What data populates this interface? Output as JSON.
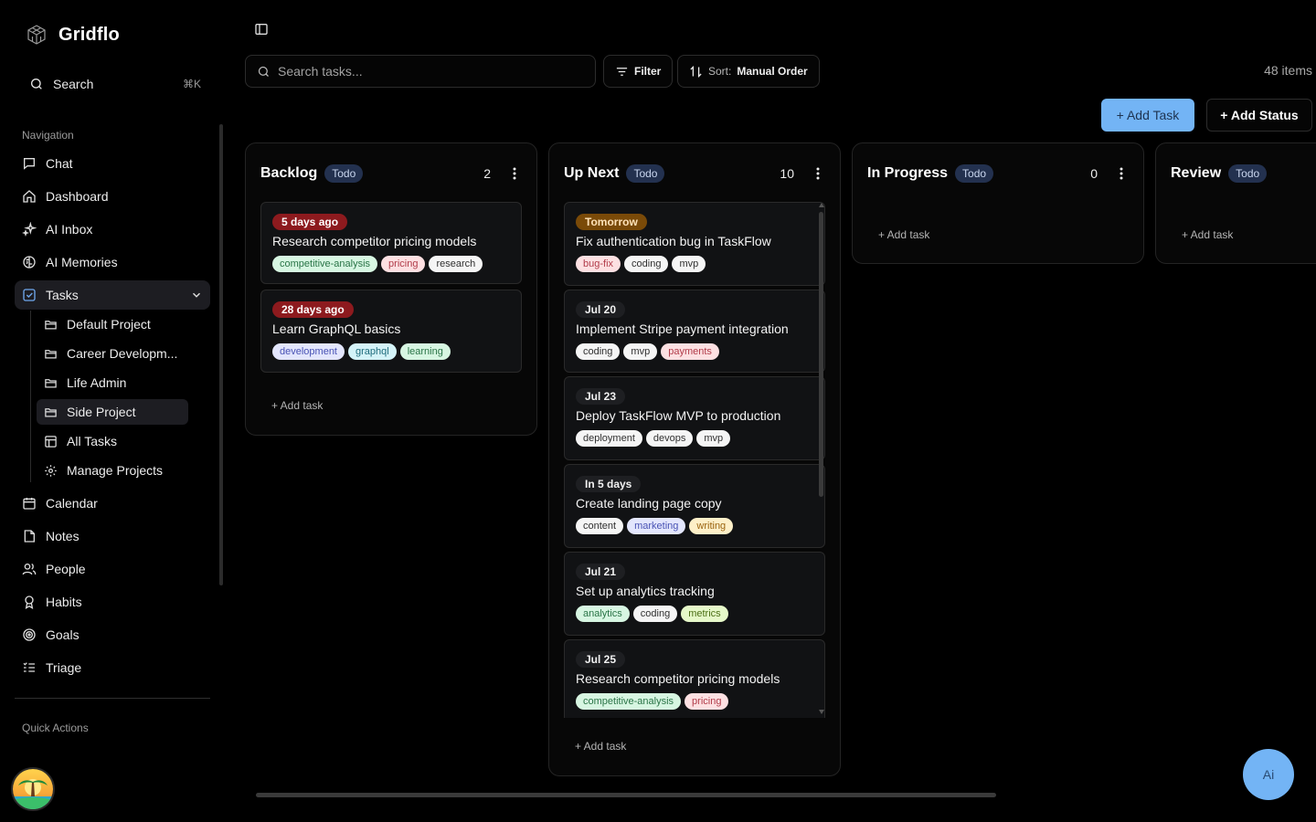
{
  "app": {
    "name": "Gridflo"
  },
  "sidebar": {
    "search_label": "Search",
    "search_shortcut": "⌘K",
    "navigation_label": "Navigation",
    "items": [
      {
        "label": "Chat",
        "icon": "chat-icon"
      },
      {
        "label": "Dashboard",
        "icon": "home-icon"
      },
      {
        "label": "AI Inbox",
        "icon": "sparkles-icon"
      },
      {
        "label": "AI Memories",
        "icon": "brain-icon"
      },
      {
        "label": "Tasks",
        "icon": "checkbox-icon",
        "active": true
      },
      {
        "label": "Calendar",
        "icon": "calendar-icon"
      },
      {
        "label": "Notes",
        "icon": "note-icon"
      },
      {
        "label": "People",
        "icon": "people-icon"
      },
      {
        "label": "Habits",
        "icon": "award-icon"
      },
      {
        "label": "Goals",
        "icon": "target-icon"
      },
      {
        "label": "Triage",
        "icon": "list-icon"
      }
    ],
    "task_subitems": [
      {
        "label": "Default Project",
        "icon": "folder-icon"
      },
      {
        "label": "Career Developm...",
        "icon": "folder-icon"
      },
      {
        "label": "Life Admin",
        "icon": "folder-icon"
      },
      {
        "label": "Side Project",
        "icon": "folder-icon",
        "active": true
      },
      {
        "label": "All Tasks",
        "icon": "table-icon"
      },
      {
        "label": "Manage Projects",
        "icon": "gear-icon"
      }
    ],
    "quick_actions_label": "Quick Actions"
  },
  "toolbar": {
    "search_placeholder": "Search tasks...",
    "filter_label": "Filter",
    "sort_prefix": "Sort:",
    "sort_value": "Manual Order",
    "items_count": "48 items",
    "add_task_label": "+ Add Task",
    "add_status_label": "+ Add Status"
  },
  "columns": [
    {
      "title": "Backlog",
      "status": "Todo",
      "count": "2",
      "add_label": "+ Add task",
      "cards": [
        {
          "due": "5 days ago",
          "due_kind": "overdue",
          "title": "Research competitor pricing models",
          "tags": [
            {
              "label": "competitive-analysis",
              "color": "green"
            },
            {
              "label": "pricing",
              "color": "pink"
            },
            {
              "label": "research",
              "color": "white"
            }
          ]
        },
        {
          "due": "28 days ago",
          "due_kind": "overdue",
          "title": "Learn GraphQL basics",
          "tags": [
            {
              "label": "development",
              "color": "lav"
            },
            {
              "label": "graphql",
              "color": "cyan"
            },
            {
              "label": "learning",
              "color": "green"
            }
          ]
        }
      ]
    },
    {
      "title": "Up Next",
      "status": "Todo",
      "count": "10",
      "add_label": "+ Add task",
      "cards": [
        {
          "due": "Tomorrow",
          "due_kind": "soon",
          "title": "Fix authentication bug in TaskFlow",
          "tags": [
            {
              "label": "bug-fix",
              "color": "pink"
            },
            {
              "label": "coding",
              "color": "white"
            },
            {
              "label": "mvp",
              "color": "white"
            }
          ]
        },
        {
          "due": "Jul 20",
          "due_kind": "normal",
          "title": "Implement Stripe payment integration",
          "tags": [
            {
              "label": "coding",
              "color": "white"
            },
            {
              "label": "mvp",
              "color": "white"
            },
            {
              "label": "payments",
              "color": "pink"
            }
          ]
        },
        {
          "due": "Jul 23",
          "due_kind": "normal",
          "title": "Deploy TaskFlow MVP to production",
          "tags": [
            {
              "label": "deployment",
              "color": "white"
            },
            {
              "label": "devops",
              "color": "white"
            },
            {
              "label": "mvp",
              "color": "white"
            }
          ]
        },
        {
          "due": "In 5 days",
          "due_kind": "normal",
          "title": "Create landing page copy",
          "tags": [
            {
              "label": "content",
              "color": "white"
            },
            {
              "label": "marketing",
              "color": "lav"
            },
            {
              "label": "writing",
              "color": "amber"
            }
          ]
        },
        {
          "due": "Jul 21",
          "due_kind": "normal",
          "title": "Set up analytics tracking",
          "tags": [
            {
              "label": "analytics",
              "color": "green"
            },
            {
              "label": "coding",
              "color": "white"
            },
            {
              "label": "metrics",
              "color": "lime"
            }
          ]
        },
        {
          "due": "Jul 25",
          "due_kind": "normal",
          "title": "Research competitor pricing models",
          "tags": [
            {
              "label": "competitive-analysis",
              "color": "green"
            },
            {
              "label": "pricing",
              "color": "pink"
            }
          ]
        }
      ]
    },
    {
      "title": "In Progress",
      "status": "Todo",
      "count": "0",
      "add_label": "+ Add task",
      "cards": []
    },
    {
      "title": "Review",
      "status": "Todo",
      "add_label": "+ Add task",
      "cards": []
    }
  ],
  "ai_button": {
    "label": "Ai"
  },
  "colors": {
    "accent": "#73b4f5",
    "overdue": "#8d1a1e",
    "soon": "#7a4a08"
  }
}
